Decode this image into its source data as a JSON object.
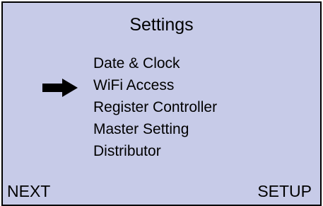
{
  "screen": {
    "title": "Settings",
    "background_color": "#c7cbe8",
    "selected_index": 1
  },
  "menu": {
    "items": [
      {
        "label": "Date & Clock"
      },
      {
        "label": "WiFi Access"
      },
      {
        "label": "Register Controller"
      },
      {
        "label": "Master Setting"
      },
      {
        "label": "Distributor"
      }
    ]
  },
  "selection_indicator": {
    "icon": "right-arrow-icon"
  },
  "softkeys": {
    "left_label": "NEXT",
    "right_label": "SETUP"
  }
}
